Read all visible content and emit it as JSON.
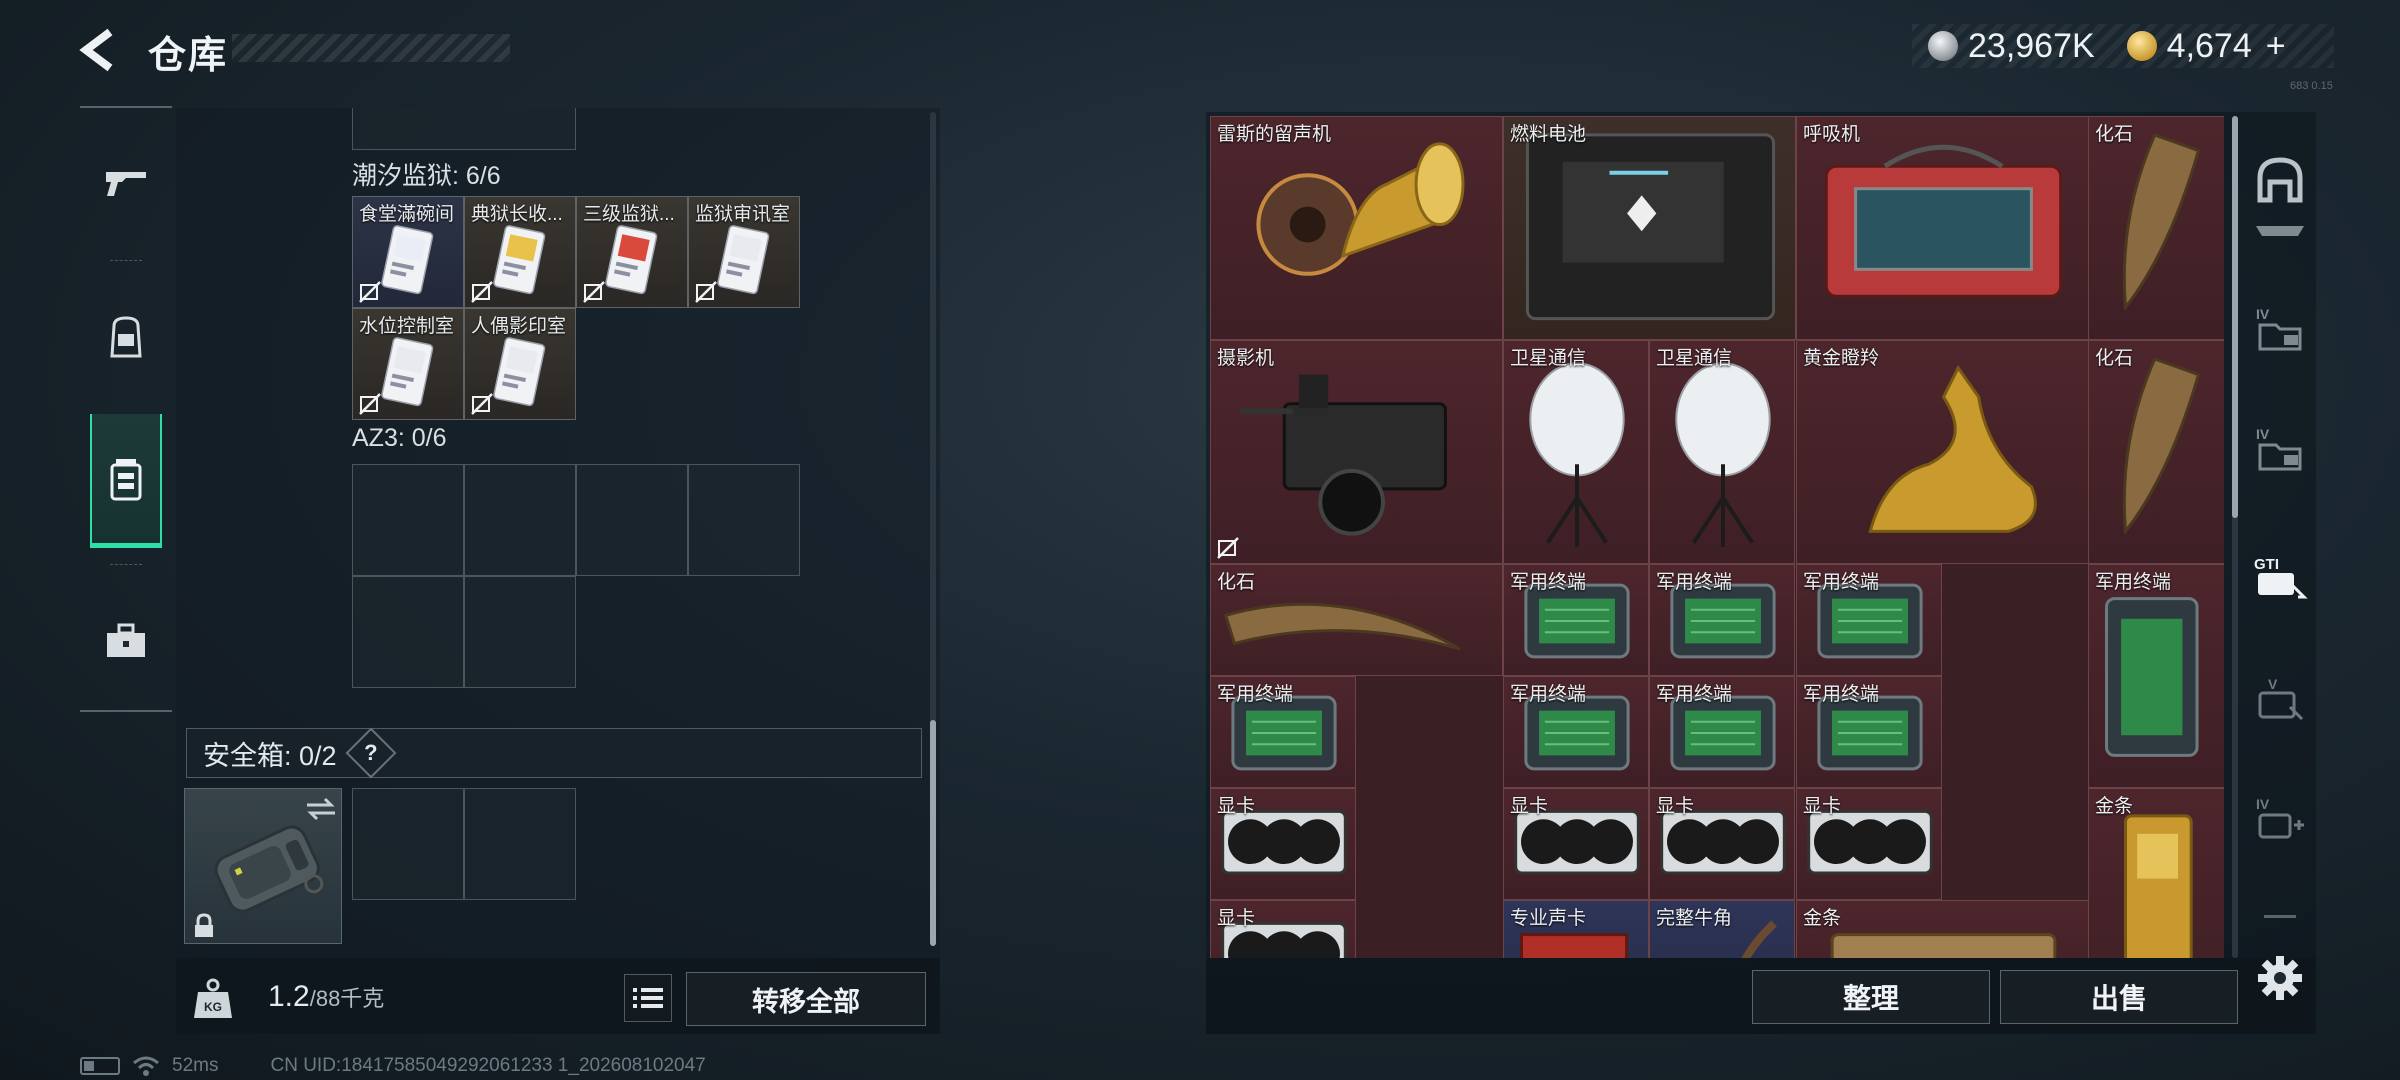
{
  "header": {
    "title": "仓库",
    "currency": [
      {
        "icon": "silver-coin-icon",
        "value": "23,967K"
      },
      {
        "icon": "gold-coin-icon",
        "value": "4,674"
      }
    ],
    "add_label": "+",
    "version": "683 0.15"
  },
  "left_nav": {
    "items": [
      {
        "icon": "gun-icon",
        "active": false
      },
      {
        "icon": "backpack-icon",
        "active": false
      },
      {
        "icon": "container-icon",
        "active": true
      },
      {
        "icon": "briefcase-icon",
        "active": false
      }
    ]
  },
  "key_section": {
    "title": "潮汐监狱: 6/6",
    "cards": [
      {
        "label": "食堂滿碗间",
        "style": "blue"
      },
      {
        "label": "典狱长收...",
        "style": "gold"
      },
      {
        "label": "三级监狱...",
        "style": "red"
      },
      {
        "label": "监狱审讯室",
        "style": "brown"
      },
      {
        "label": "水位控制室",
        "style": "brown"
      },
      {
        "label": "人偶影印室",
        "style": "brown"
      }
    ]
  },
  "az3_section": {
    "title": "AZ3: 0/6"
  },
  "safe_box": {
    "label": "安全箱: 0/2",
    "help": "?"
  },
  "bottom_left": {
    "weight_icon_label": "KG",
    "weight_current": "1.2",
    "weight_max": "/88千克",
    "transfer_label": "转移全部"
  },
  "stash": {
    "items": [
      {
        "label": "雷斯的留声机",
        "kind": "gramophone"
      },
      {
        "label": "燃料电池",
        "kind": "fuelcell"
      },
      {
        "label": "呼吸机",
        "kind": "ventilator"
      },
      {
        "label": "化石",
        "kind": "fossil"
      },
      {
        "label": "摄影机",
        "kind": "camera"
      },
      {
        "label": "卫星通信",
        "kind": "satellite"
      },
      {
        "label": "卫星通信",
        "kind": "satellite"
      },
      {
        "label": "黄金瞪羚",
        "kind": "gazelle"
      },
      {
        "label": "化石",
        "kind": "fossil"
      },
      {
        "label": "化石",
        "kind": "fossil-h"
      },
      {
        "label": "军用终端",
        "kind": "terminal"
      },
      {
        "label": "军用终端",
        "kind": "terminal"
      },
      {
        "label": "军用终端",
        "kind": "terminal"
      },
      {
        "label": "军用终端",
        "kind": "terminal-v"
      },
      {
        "label": "军用终端",
        "kind": "terminal"
      },
      {
        "label": "军用终端",
        "kind": "terminal"
      },
      {
        "label": "军用终端",
        "kind": "terminal"
      },
      {
        "label": "军用终端",
        "kind": "terminal"
      },
      {
        "label": "显卡",
        "kind": "gpu"
      },
      {
        "label": "显卡",
        "kind": "gpu"
      },
      {
        "label": "显卡",
        "kind": "gpu"
      },
      {
        "label": "显卡",
        "kind": "gpu"
      },
      {
        "label": "金条",
        "kind": "goldbar"
      },
      {
        "label": "显卡",
        "kind": "gpu"
      },
      {
        "label": "专业声卡",
        "kind": "soundcard"
      },
      {
        "label": "完整牛角",
        "kind": "horn"
      },
      {
        "label": "金条",
        "kind": "goldbar-h"
      }
    ],
    "sort_label": "整理",
    "sell_label": "出售"
  },
  "right_rail": {
    "items": [
      "helmet-icon",
      "armor-icon",
      "folder-iv-icon",
      "folder-iv-icon",
      "gti-card-icon",
      "card-key-icon",
      "iv-card-add-icon",
      "more-icon"
    ]
  },
  "status_bar": {
    "ping": "52ms",
    "uid": "CN UID:18417585049292061233 1_202608102047"
  },
  "colors": {
    "accent": "#2fe0a6",
    "stash_bg": "#4d262c",
    "panel": "#121c24"
  }
}
